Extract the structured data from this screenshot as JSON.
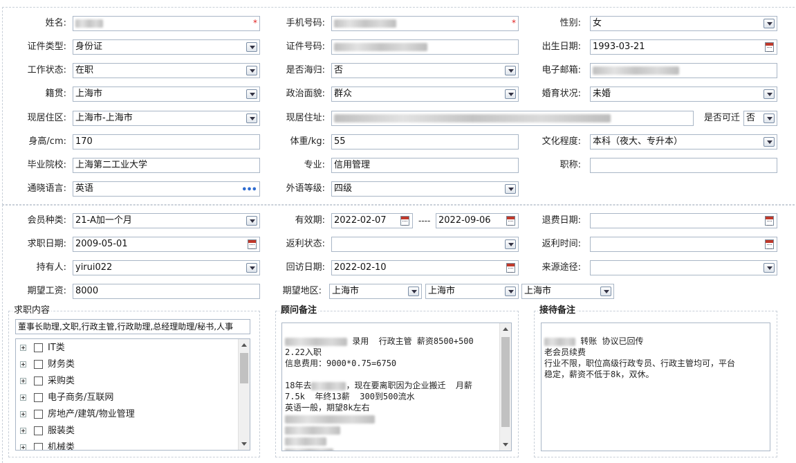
{
  "personal": {
    "name_label": "姓名:",
    "name_required": "*",
    "phone_label": "手机号码:",
    "phone_required": "*",
    "gender_label": "性别:",
    "gender_value": "女",
    "idtype_label": "证件类型:",
    "idtype_value": "身份证",
    "idno_label": "证件号码:",
    "birth_label": "出生日期:",
    "birth_value": "1993-03-21",
    "workstatus_label": "工作状态:",
    "workstatus_value": "在职",
    "returnee_label": "是否海归:",
    "returnee_value": "否",
    "email_label": "电子邮箱:",
    "native_label": "籍贯:",
    "native_value": "上海市",
    "political_label": "政治面貌:",
    "political_value": "群众",
    "marital_label": "婚育状况:",
    "marital_value": "未婚",
    "residence_label": "现居住区:",
    "residence_value": "上海市-上海市",
    "address_label": "现居住址:",
    "relocate_label": "是否可迁",
    "relocate_value": "否",
    "height_label": "身高/cm:",
    "height_value": "170",
    "weight_label": "体重/kg:",
    "weight_value": "55",
    "education_label": "文化程度:",
    "education_value": "本科（夜大、专升本）",
    "school_label": "毕业院校:",
    "school_value": "上海第二工业大学",
    "major_label": "专业:",
    "major_value": "信用管理",
    "title_label": "职称:",
    "title_value": "",
    "language_label": "通晓语言:",
    "language_value": "英语",
    "language_more": "•••",
    "foreign_level_label": "外语等级:",
    "foreign_level_value": "四级"
  },
  "member": {
    "type_label": "会员种类:",
    "type_value": "21-A加一个月",
    "valid_label": "有效期:",
    "valid_from": "2022-02-07",
    "valid_sep": "----",
    "valid_to": "2022-09-06",
    "refund_label": "退费日期:",
    "refund_value": "",
    "jobdate_label": "求职日期:",
    "jobdate_value": "2009-05-01",
    "rebate_status_label": "返利状态:",
    "rebate_status_value": "",
    "rebate_time_label": "返利时间:",
    "rebate_time_value": "",
    "holder_label": "持有人:",
    "holder_value": "yirui022",
    "visit_label": "回访日期:",
    "visit_value": "2022-02-10",
    "source_label": "来源途径:",
    "source_value": "",
    "salary_label": "期望工资:",
    "salary_value": "8000",
    "region_label": "期望地区:",
    "region_1": "上海市",
    "region_2": "上海市",
    "region_3": "上海市"
  },
  "job_content": {
    "title": "求职内容",
    "selected_text": "董事长助理,文职,行政主管,行政助理,总经理助理/秘书,人事",
    "tree": [
      "IT类",
      "财务类",
      "采购类",
      "电子商务/互联网",
      "房地产/建筑/物业管理",
      "服装类",
      "机械类"
    ]
  },
  "advisor_note": {
    "title": "顾问备注",
    "lines": [
      "录用  行政主管 薪资8500+500",
      "2.22入职",
      "信息费用：9000*0.75=6750",
      "",
      "18年去",
      "，现在要离职因为企业搬迁  月薪",
      "7.5k  年终13薪  300到500流水",
      "英语一般，期望8k左右"
    ]
  },
  "reception_note": {
    "title": "接待备注",
    "lines": [
      "转账 协议已回传",
      "老会员续费",
      "行业不限，职位高级行政专员、行政主管均可，平台",
      "稳定，薪资不低于8k，双休。"
    ]
  }
}
